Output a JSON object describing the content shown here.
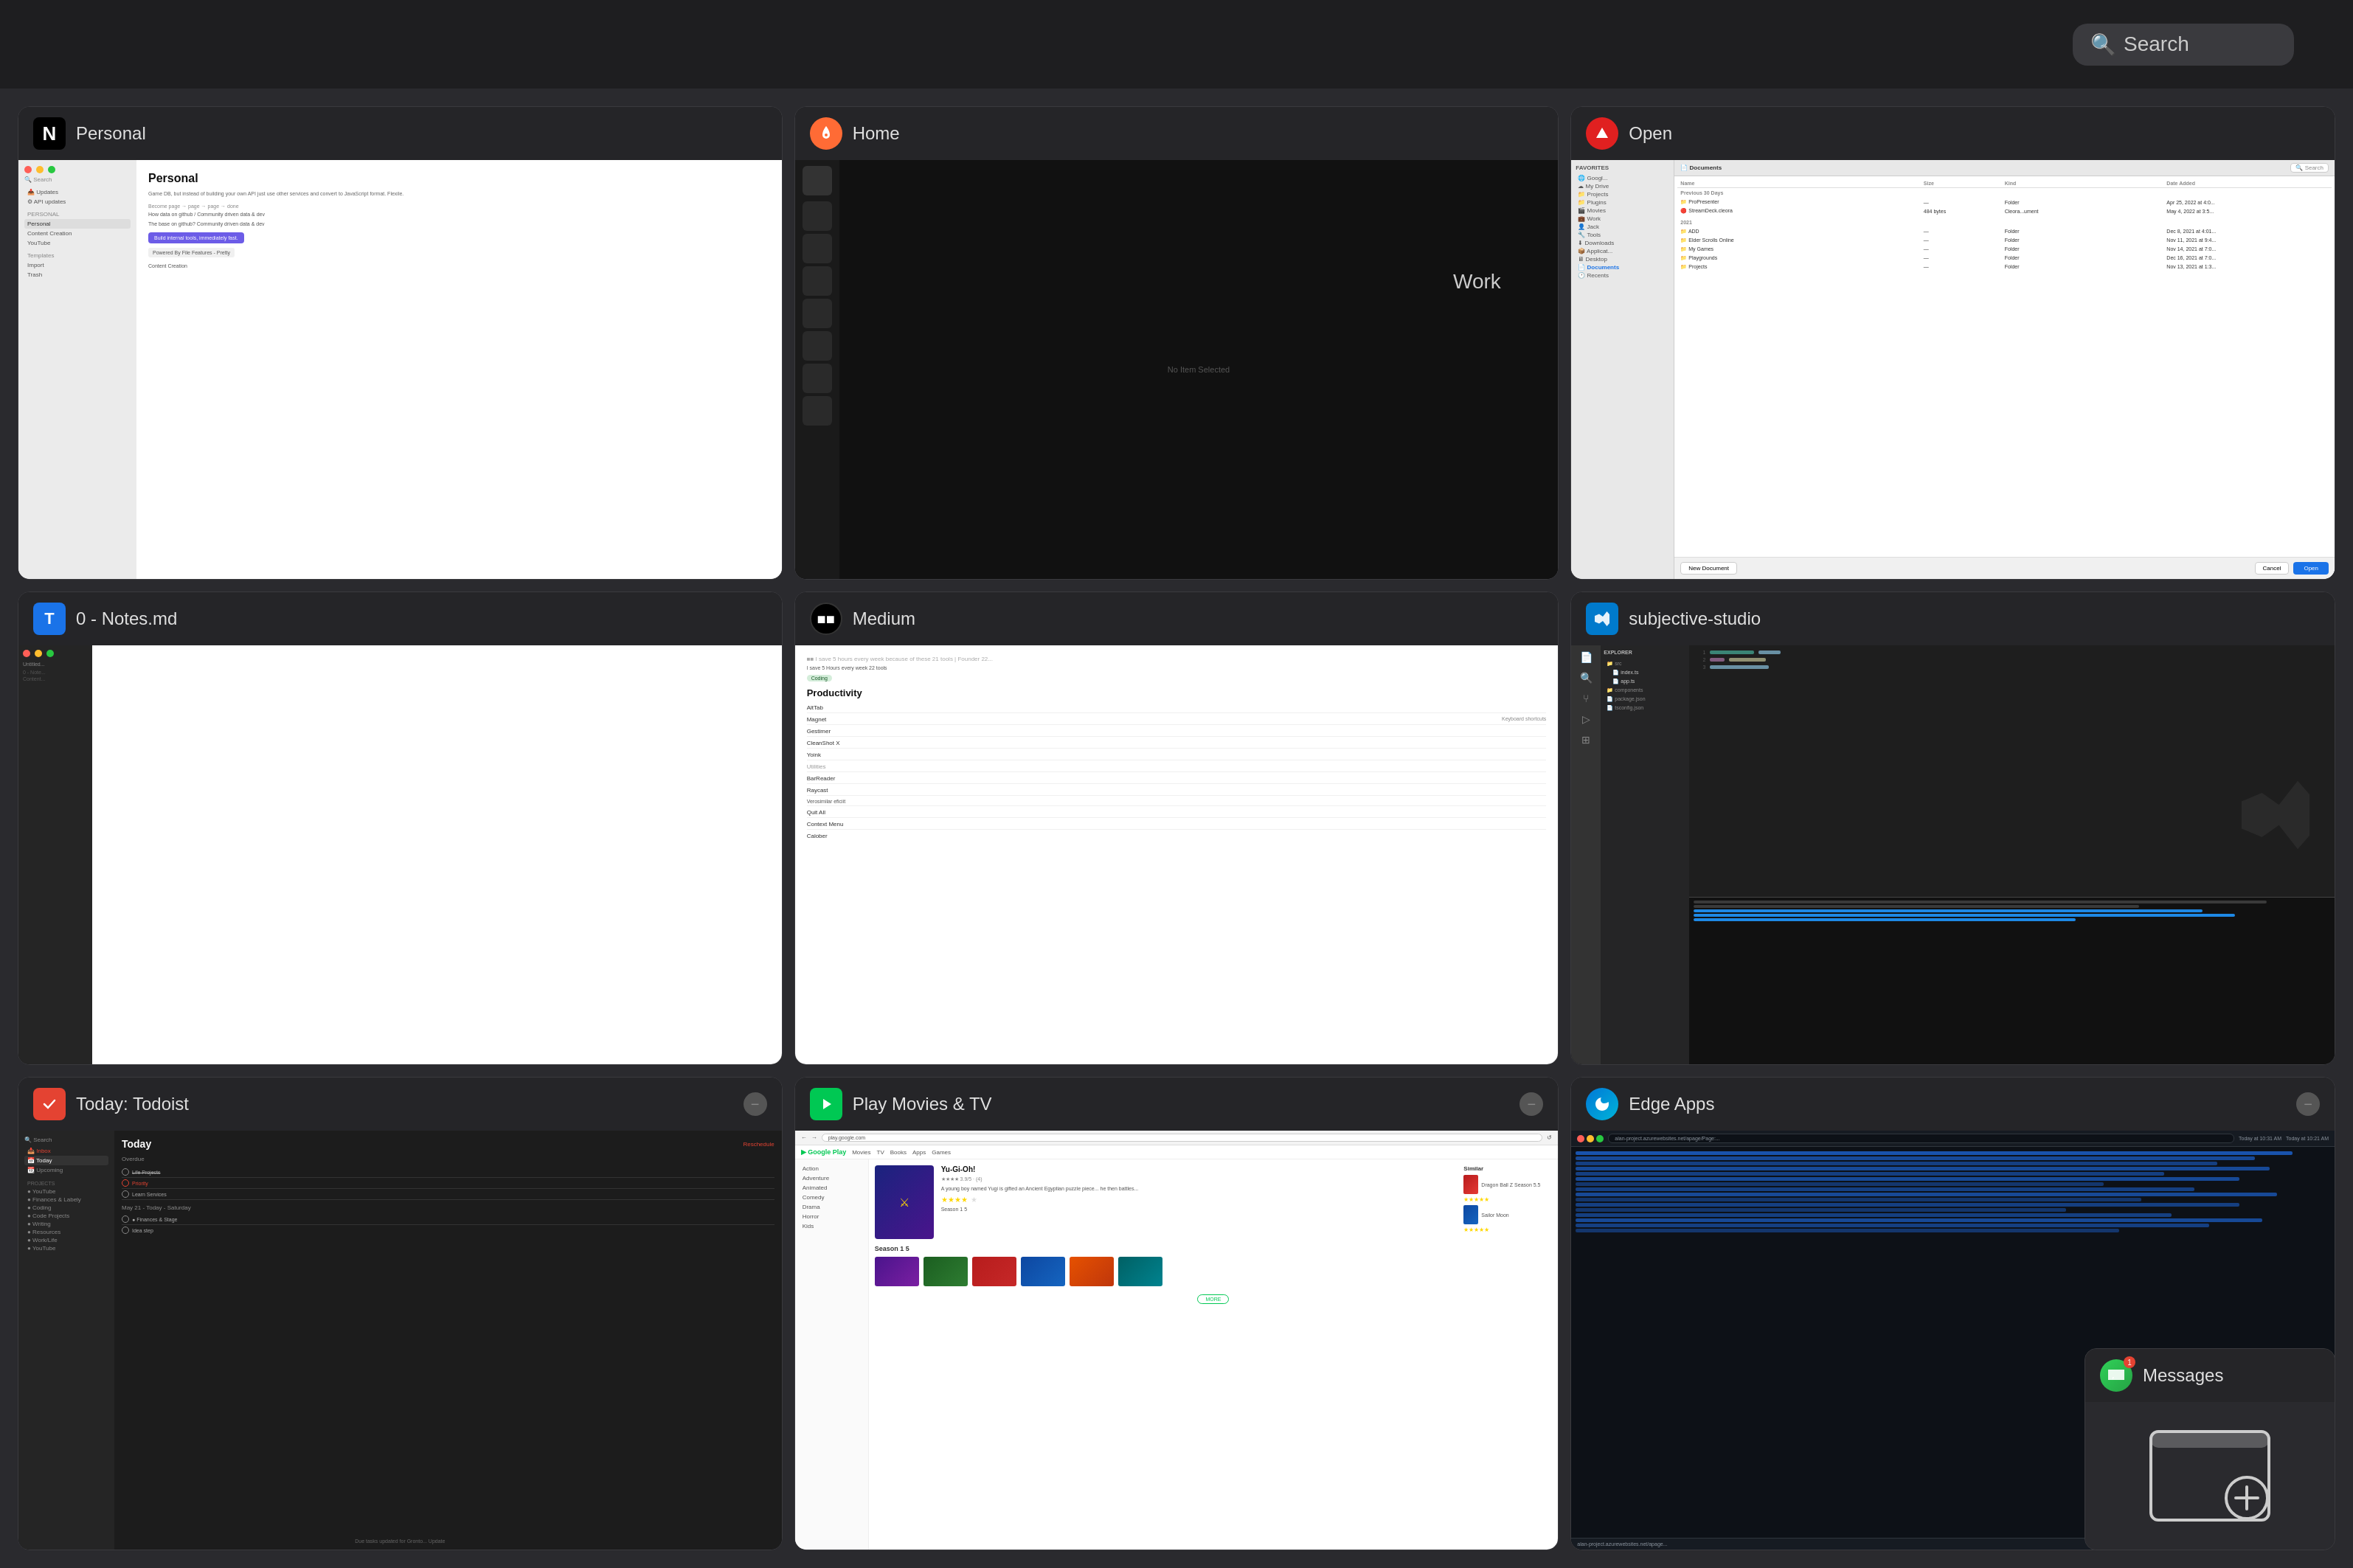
{
  "topbar": {
    "search_placeholder": "Search"
  },
  "windows": [
    {
      "id": "personal",
      "title": "Personal",
      "icon": "notion",
      "icon_char": "N",
      "icon_bg": "#000",
      "icon_color": "#fff",
      "row": 0,
      "col": 0
    },
    {
      "id": "home",
      "title": "Home",
      "icon": "home",
      "icon_char": "🚀",
      "icon_bg": "#ff6b35",
      "icon_color": "#fff",
      "row": 0,
      "col": 1
    },
    {
      "id": "open",
      "title": "Open",
      "icon": "open",
      "icon_char": "⬡",
      "icon_bg": "#e02020",
      "icon_color": "#fff",
      "row": 0,
      "col": 2,
      "finder": {
        "path": "Documents",
        "columns": [
          "Name",
          "Size",
          "Kind",
          "Date Added"
        ],
        "favorites": [
          "Google...",
          "My Drive",
          "Projects",
          "Plugins",
          "Movies",
          "Work",
          "Jack",
          "Tools",
          "Downloads",
          "Applicat...",
          "Desktop",
          "Documents",
          "Recents"
        ],
        "recent_header": "Previous 30 Days",
        "rows": [
          {
            "name": "ProPresenter",
            "size": "—",
            "kind": "Folder",
            "date": "Apr 25, 2022 at 4:0..."
          },
          {
            "name": "StreamDeck.cleora",
            "size": "484 bytes",
            "kind": "Cleora...ument",
            "date": "May 4, 2022 at 3:5..."
          }
        ],
        "year_header": "2021",
        "rows2": [
          {
            "name": "ADD",
            "size": "—",
            "kind": "Folder",
            "date": "Dec 8, 2021 at 4:01..."
          },
          {
            "name": "Elder Scrolls Online",
            "size": "—",
            "kind": "Folder",
            "date": "Nov 11, 2021 at 9:4..."
          },
          {
            "name": "My Games",
            "size": "—",
            "kind": "Folder",
            "date": "Nov 14, 2021 at 7:0..."
          },
          {
            "name": "Playgrounds",
            "size": "—",
            "kind": "Folder",
            "date": "Dec 16, 2021 at 7:0..."
          },
          {
            "name": "Projects",
            "size": "—",
            "kind": "Folder",
            "date": "Nov 13, 2021 at 1:3..."
          }
        ],
        "buttons": [
          "New Document",
          "Cancel",
          "Open"
        ]
      }
    },
    {
      "id": "notes",
      "title": "0 - Notes.md",
      "icon": "typora",
      "icon_char": "T",
      "icon_bg": "#1a73e8",
      "icon_color": "#fff",
      "row": 1,
      "col": 0
    },
    {
      "id": "medium",
      "title": "Medium",
      "icon": "medium",
      "icon_char": "●",
      "icon_bg": "#000",
      "icon_color": "#fff",
      "row": 1,
      "col": 1,
      "article": {
        "title": "Productivity",
        "items": [
          "AltTab",
          "Magnet",
          "Gestimer",
          "CleanShot X",
          "Yoink",
          "Utilities",
          "BarReader",
          "Raycast",
          "Verosimilar...",
          "Quit All",
          "Context Menu",
          "Calober"
        ]
      }
    },
    {
      "id": "vscode",
      "title": "subjective-studio",
      "icon": "vscode",
      "icon_char": "VS",
      "icon_bg": "#007acc",
      "icon_color": "#fff",
      "row": 1,
      "col": 2
    },
    {
      "id": "todoist",
      "title": "Today: Todoist",
      "icon": "todoist",
      "icon_char": "✓",
      "icon_bg": "#e44332",
      "icon_color": "#fff",
      "row": 2,
      "col": 0,
      "minimize": true
    },
    {
      "id": "playmovies",
      "title": "Play Movies & TV",
      "icon": "playmovies",
      "icon_char": "▶",
      "icon_bg": "#00c853",
      "icon_color": "#fff",
      "row": 2,
      "col": 1,
      "minimize": true
    },
    {
      "id": "edgeapps",
      "title": "Edge Apps",
      "icon": "edge",
      "icon_char": "e",
      "icon_bg": "#0078d7",
      "icon_color": "#fff",
      "row": 2,
      "col": 2,
      "minimize": true
    }
  ],
  "messages": {
    "title": "Messages",
    "icon_char": "💬",
    "badge": "1"
  },
  "work_label": "Work",
  "add_window_label": "+"
}
